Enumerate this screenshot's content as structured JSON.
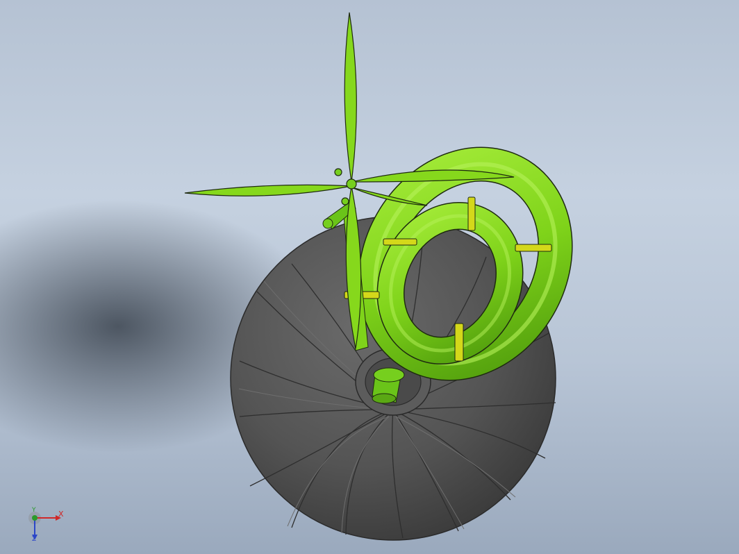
{
  "viewport": {
    "background_top": "#b5c2d3",
    "background_bottom": "#9aa9bd",
    "shadow_color": "#28303a"
  },
  "model": {
    "sphere_color": "#555555",
    "sphere_rib_color": "#3c3c3c",
    "pipe_color": "#7fd31a",
    "pipe_band_color": "#d4d81a",
    "blade_color": "#86d81c",
    "outline_color": "#1e2a10"
  },
  "triad": {
    "x_label": "X",
    "y_label": "Y",
    "z_label": "Z",
    "x_color": "#d02828",
    "y_color": "#2a9a2a",
    "z_color": "#2b46c8"
  }
}
